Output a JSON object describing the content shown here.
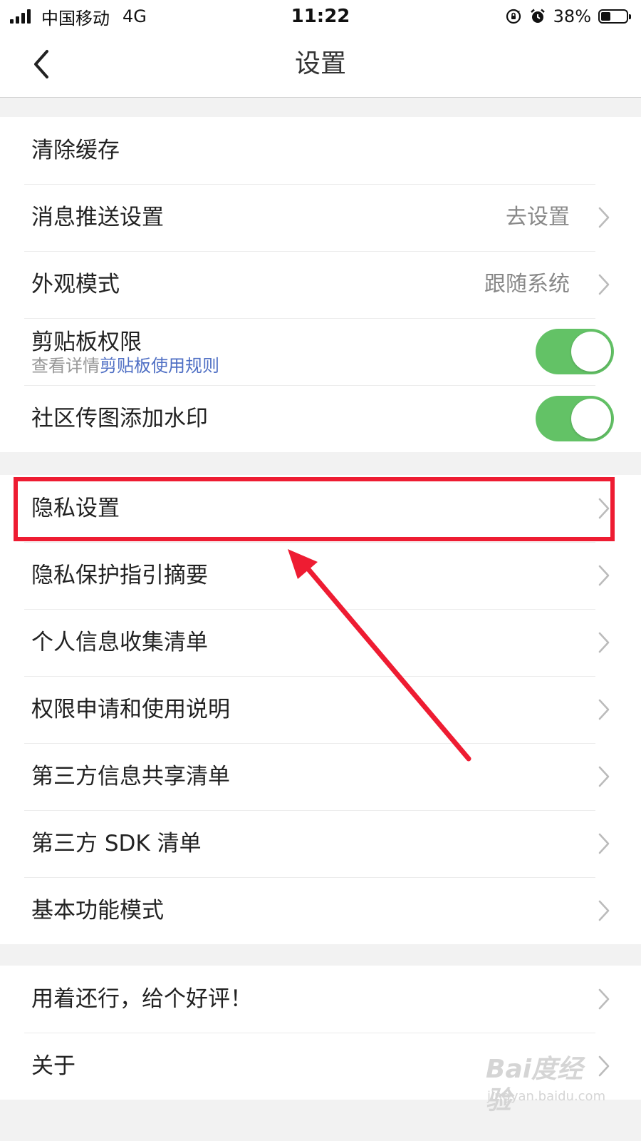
{
  "status_bar": {
    "carrier": "中国移动",
    "network": "4G",
    "time": "11:22",
    "battery_percent": "38%",
    "battery_level": 0.38,
    "icons": [
      "signal-icon",
      "orientation-lock-icon",
      "alarm-icon",
      "battery-icon"
    ]
  },
  "nav": {
    "title": "设置",
    "back_icon": "chevron-left-icon"
  },
  "groups": [
    {
      "rows": [
        {
          "label": "清除缓存"
        },
        {
          "label": "消息推送设置",
          "value": "去设置",
          "chevron": true
        },
        {
          "label": "外观模式",
          "value": "跟随系统",
          "chevron": true
        },
        {
          "label": "剪贴板权限",
          "sub_prefix": "查看详情",
          "sub_link": "剪贴板使用规则",
          "toggle": true
        },
        {
          "label": "社区传图添加水印",
          "toggle": true
        }
      ]
    },
    {
      "rows": [
        {
          "label": "隐私设置",
          "chevron": true,
          "highlighted": true
        },
        {
          "label": "隐私保护指引摘要",
          "chevron": true
        },
        {
          "label": "个人信息收集清单",
          "chevron": true
        },
        {
          "label": "权限申请和使用说明",
          "chevron": true
        },
        {
          "label": "第三方信息共享清单",
          "chevron": true
        },
        {
          "label": "第三方 SDK 清单",
          "chevron": true
        },
        {
          "label": "基本功能模式",
          "chevron": true
        }
      ]
    },
    {
      "rows": [
        {
          "label": "用着还行，给个好评！",
          "chevron": true
        },
        {
          "label": "关于",
          "chevron": true
        }
      ]
    }
  ],
  "annotation": {
    "color": "#ee1c32"
  },
  "colors": {
    "toggle_on": "#63c266",
    "link": "#4f6fc4",
    "background": "#f2f2f2"
  },
  "watermark": {
    "logo": "Bai度经验",
    "url": "jingyan.baidu.com"
  }
}
